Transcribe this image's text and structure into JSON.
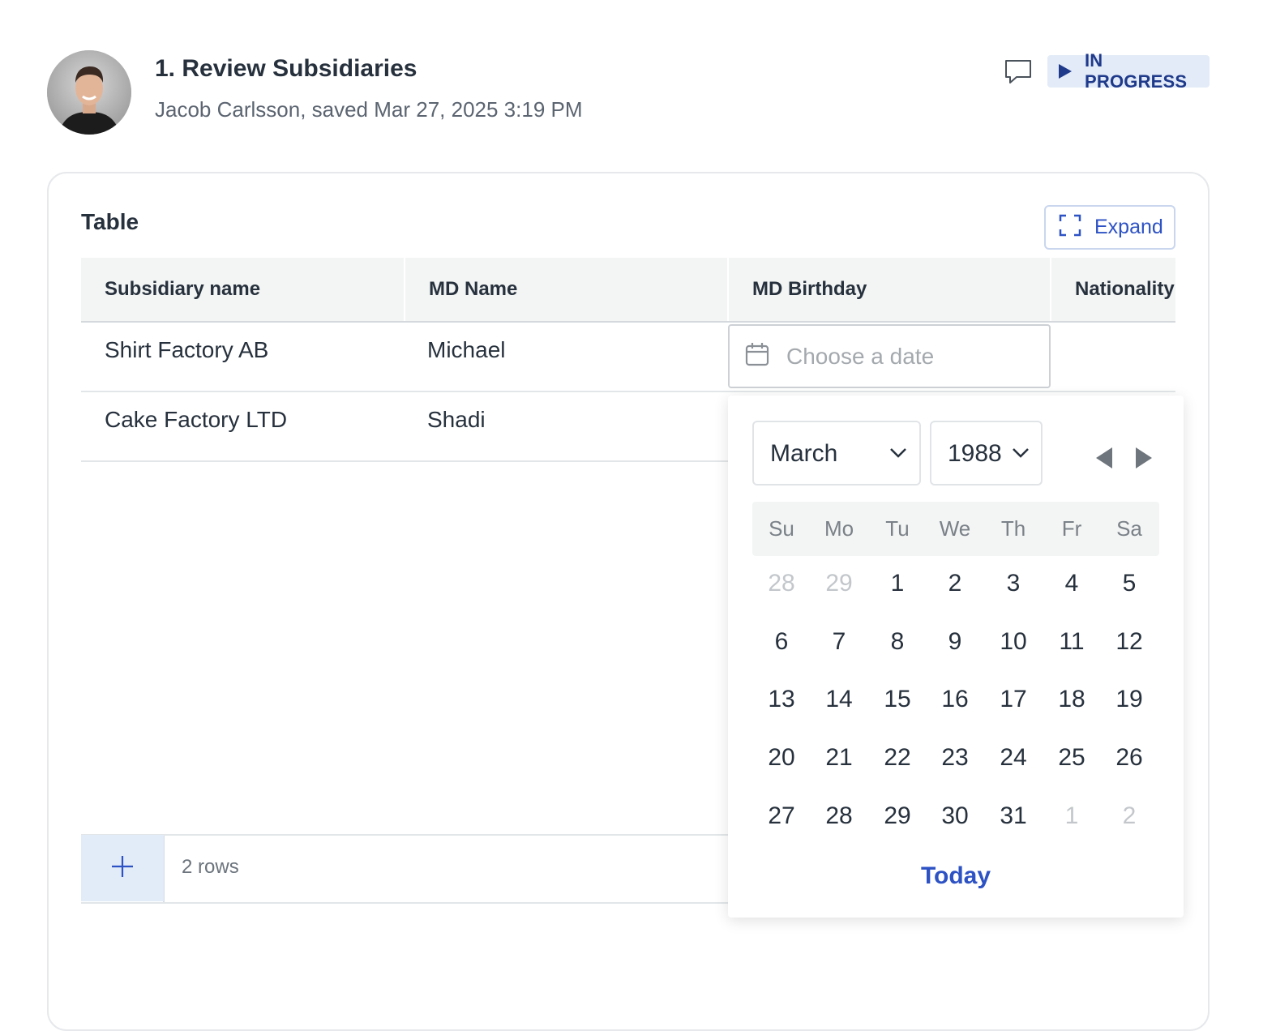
{
  "header": {
    "title": "1. Review Subsidiaries",
    "subtitle": "Jacob Carlsson, saved Mar 27, 2025 3:19 PM",
    "status": "IN PROGRESS"
  },
  "card": {
    "title": "Table",
    "expand_label": "Expand"
  },
  "table": {
    "columns": [
      "Subsidiary name",
      "MD Name",
      "MD Birthday",
      "Nationality"
    ],
    "rows": [
      [
        "Shirt Factory AB",
        "Michael",
        "",
        ""
      ],
      [
        "Cake Factory LTD",
        "Shadi",
        "",
        ""
      ]
    ],
    "date_placeholder": "Choose a date",
    "rows_count": "2 rows"
  },
  "calendar": {
    "month": "March",
    "year": "1988",
    "weekdays": [
      "Su",
      "Mo",
      "Tu",
      "We",
      "Th",
      "Fr",
      "Sa"
    ],
    "weeks": [
      [
        "28",
        "29",
        "1",
        "2",
        "3",
        "4",
        "5"
      ],
      [
        "6",
        "7",
        "8",
        "9",
        "10",
        "11",
        "12"
      ],
      [
        "13",
        "14",
        "15",
        "16",
        "17",
        "18",
        "19"
      ],
      [
        "20",
        "21",
        "22",
        "23",
        "24",
        "25",
        "26"
      ],
      [
        "27",
        "28",
        "29",
        "30",
        "31",
        "1",
        "2"
      ]
    ],
    "today_label": "Today"
  },
  "icons": {
    "comment": "comment-icon",
    "play": "play-icon",
    "expand": "expand-icon",
    "calendar": "calendar-icon",
    "plus": "plus-icon",
    "chevron": "chevron-down-icon",
    "prev": "prev-month-icon",
    "next": "next-month-icon"
  },
  "colors": {
    "accent": "#2d52c4",
    "badge_bg": "#e3ebf8",
    "badge_text": "#1f3a8a"
  }
}
